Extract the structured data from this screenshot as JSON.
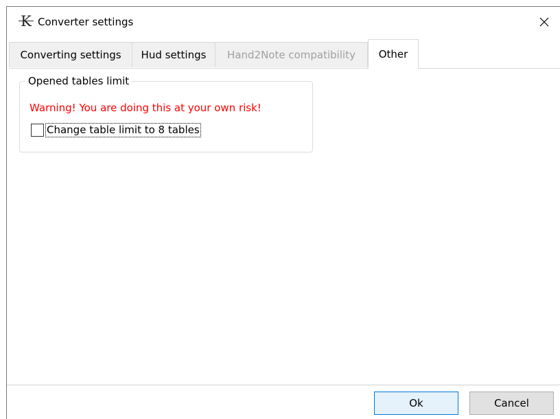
{
  "window": {
    "title": "Converter settings",
    "logo_letter": "K"
  },
  "tabs": [
    {
      "label": "Converting settings",
      "state": "normal"
    },
    {
      "label": "Hud settings",
      "state": "normal"
    },
    {
      "label": "Hand2Note compatibility",
      "state": "disabled"
    },
    {
      "label": "Other",
      "state": "active"
    }
  ],
  "group": {
    "legend": "Opened tables limit",
    "warning": "Warning! You are doing this at your own risk!",
    "checkbox_label": "Change table limit to 8 tables",
    "checkbox_checked": false
  },
  "buttons": {
    "ok": "Ok",
    "cancel": "Cancel"
  },
  "colors": {
    "warning": "#ff0000",
    "ok_border": "#0078d7",
    "disabled_text": "#a0a0a0"
  },
  "icons": {
    "close": "close-icon",
    "logo": "app-logo-icon"
  }
}
